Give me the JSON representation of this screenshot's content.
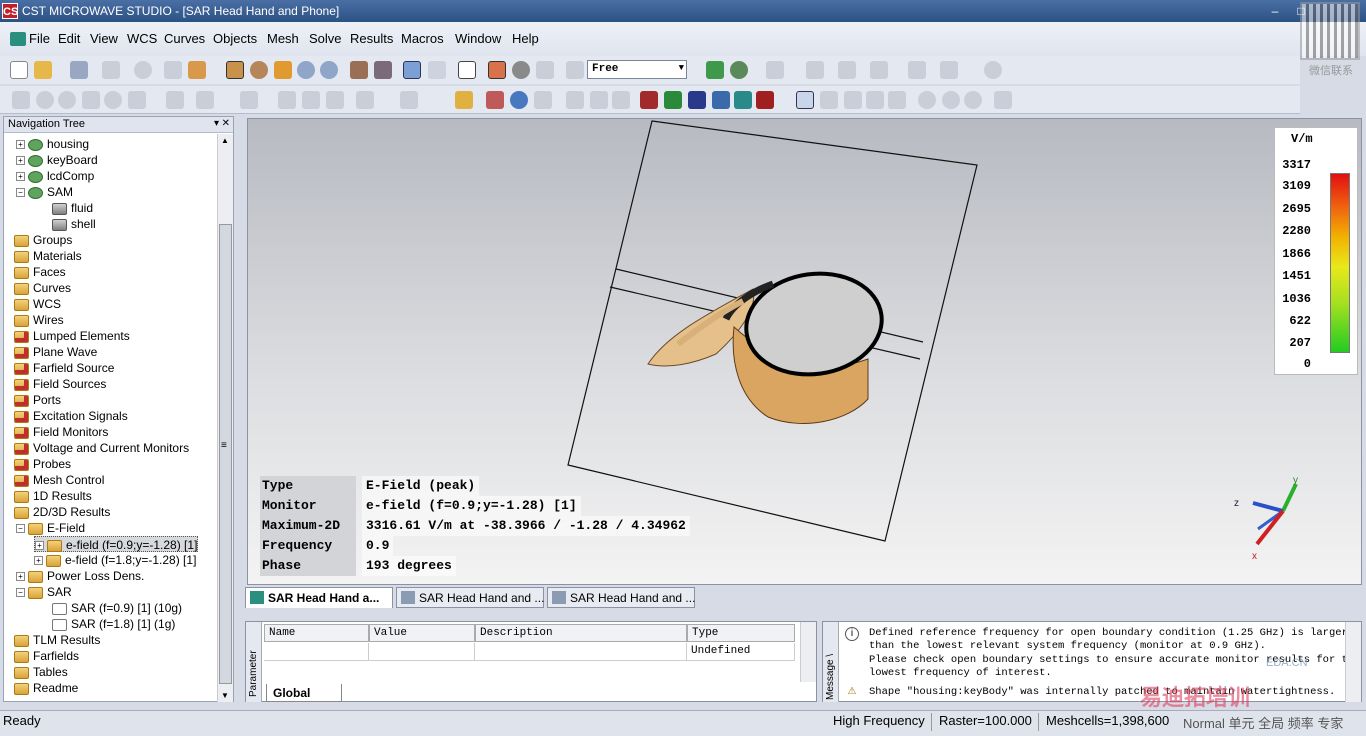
{
  "window": {
    "title": "CST MICROWAVE STUDIO - [SAR Head Hand and Phone]",
    "app_icon": "CS",
    "min": "–",
    "max": "□",
    "close": "✕"
  },
  "watermark": {
    "qr_text": "微信联系",
    "overlay": "易迪拓培训",
    "url": "EDA.CN"
  },
  "menu": [
    "File",
    "Edit",
    "View",
    "WCS",
    "Curves",
    "Objects",
    "Mesh",
    "Solve",
    "Results",
    "Macros",
    "Window",
    "Help"
  ],
  "toolbar": {
    "combo_value": "Free",
    "combo_arrow": "▼"
  },
  "nav": {
    "title": "Navigation Tree",
    "pin": "▾",
    "close": "✕",
    "expand_plus": "+",
    "expand_minus": "−",
    "items": [
      "housing",
      "keyBoard",
      "lcdComp",
      "SAM",
      "fluid",
      "shell",
      "Groups",
      "Materials",
      "Faces",
      "Curves",
      "WCS",
      "Wires",
      "Lumped Elements",
      "Plane Wave",
      "Farfield Source",
      "Field Sources",
      "Ports",
      "Excitation Signals",
      "Field Monitors",
      "Voltage and Current Monitors",
      "Probes",
      "Mesh Control",
      "1D Results",
      "2D/3D Results",
      "E-Field",
      "e-field (f=0.9;y=-1.28) [1]",
      "e-field (f=1.8;y=-1.28) [1]",
      "Power Loss Dens.",
      "SAR",
      "SAR (f=0.9) [1] (10g)",
      "SAR (f=1.8) [1] (1g)",
      "TLM Results",
      "Farfields",
      "Tables",
      "Readme"
    ],
    "scroll_up": "▲",
    "scroll_down": "▼",
    "scroll_grip": "≡"
  },
  "legend": {
    "unit": "V/m",
    "values": [
      "3317",
      "3109",
      "2695",
      "2280",
      "1866",
      "1451",
      "1036",
      "622",
      "207",
      "0"
    ]
  },
  "info": {
    "labels": [
      "Type",
      "Monitor",
      "Maximum-2D",
      "Frequency",
      "Phase"
    ],
    "values": [
      "E-Field (peak)",
      "e-field (f=0.9;y=-1.28) [1]",
      "3316.61 V/m at -38.3966 / -1.28 / 4.34962",
      "0.9",
      "193 degrees"
    ]
  },
  "axes": {
    "x": "x",
    "y": "y",
    "z": "z"
  },
  "view_tabs": [
    "SAR Head Hand a...",
    "SAR Head Hand and ...",
    "SAR Head Hand and ..."
  ],
  "params": {
    "side_label": "Parameter",
    "headers": [
      "Name",
      "Value",
      "Description",
      "Type"
    ],
    "row": [
      "",
      "",
      "",
      "Undefined"
    ],
    "tab": "Global"
  },
  "messages": {
    "side_label": "Message \\ ",
    "lines": [
      "Defined reference frequency for open boundary condition (1.25 GHz) is larger",
      "than the lowest relevant system frequency (monitor at 0.9 GHz).",
      "Please check open boundary settings to ensure accurate monitor results for the",
      "lowest frequency of interest.",
      "Shape \"housing:keyBody\" was internally patched to maintain watertightness."
    ]
  },
  "status": {
    "ready": "Ready",
    "solver": "High Frequency",
    "raster": "Raster=100.000",
    "meshcells": "Meshcells=1,398,600",
    "units": "Normal 单元 全局 频率 专家"
  }
}
